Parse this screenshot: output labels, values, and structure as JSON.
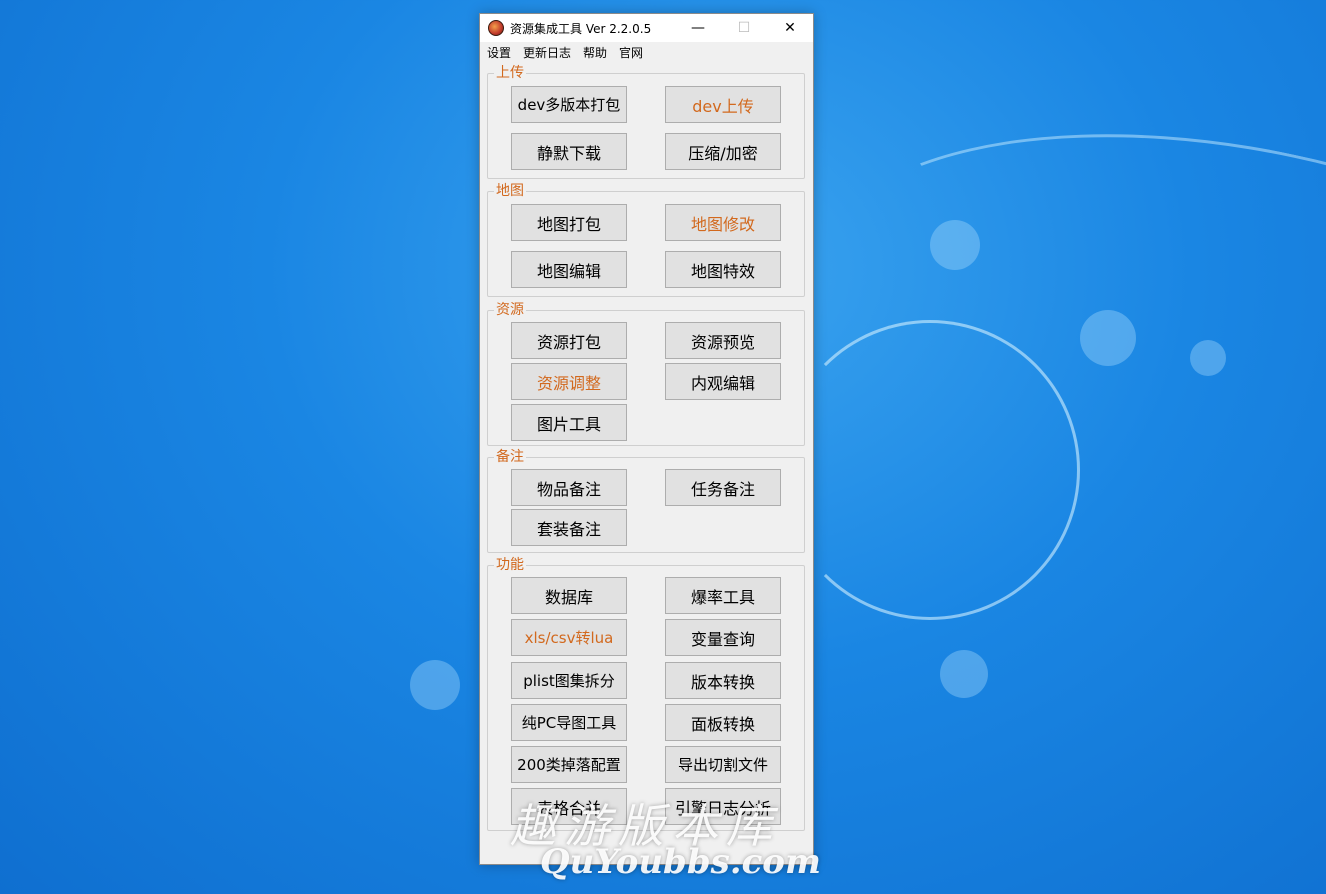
{
  "window": {
    "title": "资源集成工具 Ver 2.2.0.5",
    "controls": {
      "minimize": "—",
      "maximize": "☐",
      "close": "✕"
    }
  },
  "menu": [
    "设置",
    "更新日志",
    "帮助",
    "官网"
  ],
  "groups": {
    "upload": {
      "label": "上传",
      "buttons": [
        "dev多版本打包",
        "dev上传",
        "静默下载",
        "压缩/加密"
      ]
    },
    "map": {
      "label": "地图",
      "buttons": [
        "地图打包",
        "地图修改",
        "地图编辑",
        "地图特效"
      ]
    },
    "resource": {
      "label": "资源",
      "buttons": [
        "资源打包",
        "资源预览",
        "资源调整",
        "内观编辑",
        "图片工具"
      ]
    },
    "notes": {
      "label": "备注",
      "buttons": [
        "物品备注",
        "任务备注",
        "套装备注"
      ]
    },
    "function": {
      "label": "功能",
      "buttons": [
        "数据库",
        "爆率工具",
        "xls/csv转lua",
        "变量查询",
        "plist图集拆分",
        "版本转换",
        "纯PC导图工具",
        "面板转换",
        "200类掉落配置",
        "导出切割文件",
        "表格合并",
        "引擎日志分析"
      ]
    }
  },
  "watermark": {
    "cn": "趣游版本库",
    "en": "QuYoubbs.com"
  },
  "colors": {
    "accent": "#d2691e",
    "button_bg": "#e1e1e1",
    "window_bg": "#f0f0f0"
  }
}
